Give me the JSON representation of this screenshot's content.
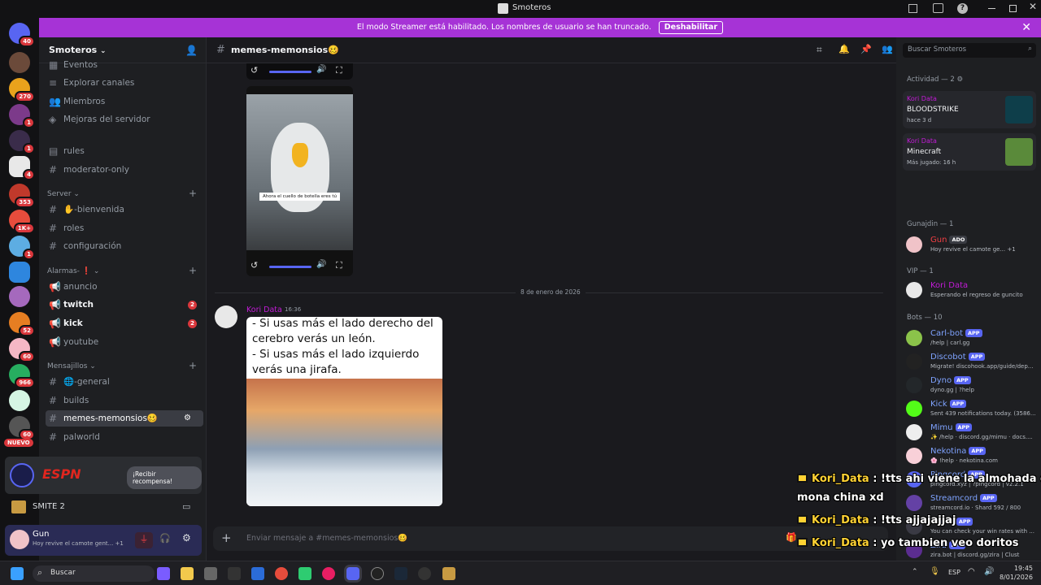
{
  "window": {
    "title": "Smoteros"
  },
  "banner": {
    "text": "El modo Streamer está habilitado. Los nombres de usuario se han truncado.",
    "button": "Deshabilitar"
  },
  "rail": {
    "badges": [
      "40",
      "270",
      "1",
      "1",
      "4",
      "353",
      "1K+",
      "1",
      "52",
      "60",
      "966",
      "60"
    ],
    "new_label": "NUEVO"
  },
  "server": {
    "name": "Smoteros"
  },
  "sidebar": {
    "top_items": [
      {
        "label": "Eventos"
      },
      {
        "label": "Explorar canales"
      },
      {
        "label": "Miembros"
      },
      {
        "label": "Mejoras del servidor"
      }
    ],
    "pre_channels": [
      {
        "label": "rules"
      },
      {
        "label": "moderator-only"
      }
    ],
    "categories": {
      "server": "Server",
      "alarmas": "Alarmas- ❗",
      "mensajillos": "Mensajillos"
    },
    "server_channels": [
      {
        "label": "✋-bienvenida"
      },
      {
        "label": "roles"
      },
      {
        "label": "configuración"
      }
    ],
    "alarm_channels": [
      {
        "label": "anuncio"
      },
      {
        "label": "twitch",
        "count": "2"
      },
      {
        "label": "kick",
        "count": "2"
      },
      {
        "label": "youtube"
      }
    ],
    "msg_channels": [
      {
        "label": "🌐-general"
      },
      {
        "label": "builds"
      },
      {
        "label": "memes-memonsios🥴"
      },
      {
        "label": "palworld"
      }
    ]
  },
  "promo": {
    "brand": "ESPN",
    "button": "¡Recibir recompensa!"
  },
  "game": {
    "name": "SMITE 2"
  },
  "user": {
    "name": "Gun",
    "status": "Hoy revive el camote gent...",
    "extra": "+1"
  },
  "chat": {
    "channel": "memes-memonsios🥴",
    "caption_bird": "Ahora el cuello de botella eres tú",
    "date_divider": "8 de enero de 2026",
    "message": {
      "author": "Kori Data",
      "time": "16:36",
      "image_text": "- Si usas más el lado derecho del cerebro verás un león.\n- Si usas más el lado izquierdo verás una jirafa."
    },
    "composer_placeholder": "Enviar mensaje a #memes-memonsios🥴"
  },
  "members": {
    "search_placeholder": "Buscar Smoteros",
    "activity_header": "Actividad — 2",
    "activity": [
      {
        "user": "Kori Data",
        "game": "BLOODSTRIKE",
        "meta": "hace 3 d"
      },
      {
        "user": "Kori Data",
        "game": "Minecraft",
        "meta": "Más jugado: 16 h"
      }
    ],
    "groups": [
      {
        "header": "Gunajdin — 1",
        "rows": [
          {
            "name": "Gun",
            "tag": "ADO",
            "status": "Hoy revive el camote ge...  +1",
            "color": "#f23f43"
          }
        ]
      },
      {
        "header": "VIP — 1",
        "rows": [
          {
            "name": "Kori Data",
            "status": "Esperando el regreso de guncito",
            "color": "#c21bd6"
          }
        ]
      },
      {
        "header": "Bots — 10",
        "rows": [
          {
            "name": "Carl-bot",
            "status": "/help | carl.gg",
            "color": "#7fa3ff"
          },
          {
            "name": "Discobot",
            "status": "Migrate! discohook.app/guide/dep...",
            "color": "#7fa3ff"
          },
          {
            "name": "Dyno",
            "status": "dyno.gg | ?help",
            "color": "#7fa3ff"
          },
          {
            "name": "Kick",
            "status": "Sent 439 notifications today. (3586...",
            "color": "#7fa3ff"
          },
          {
            "name": "Mimu",
            "status": "✨ /help · discord.gg/mimu · docs....",
            "color": "#7fa3ff"
          },
          {
            "name": "Nekotina",
            "status": "🌸 !help · nekotina.com",
            "color": "#7fa3ff"
          },
          {
            "name": "Pingcord",
            "status": "pingcord.xyz | ?pingcord | v2.2.1",
            "color": "#7fa3ff"
          },
          {
            "name": "Streamcord",
            "status": "streamcord.io · Shard 592 / 800",
            "color": "#7fa3ff"
          },
          {
            "name": "Tnoth",
            "status": "You can check your win rates with ...",
            "color": "#7fa3ff"
          },
          {
            "name": "Zira",
            "status": "zira.bot | discord.gg/zira | Clust",
            "color": "#7fa3ff"
          }
        ]
      }
    ],
    "app_tag": "APP"
  },
  "overlay": [
    {
      "name": "Kori_Data",
      "text": " : !tts ahi viene la almohada de"
    },
    {
      "name": "",
      "text": "mona china xd"
    },
    {
      "name": "Kori_Data",
      "text": " : !tts ajjajajjaj"
    },
    {
      "name": "Kori_Data",
      "text": " : yo tambien veo doritos"
    }
  ],
  "taskbar": {
    "search": "Buscar",
    "lang": "ESP",
    "time": "19:45",
    "date": "8/01/2026"
  },
  "colors": {
    "accent": "#a633d6",
    "username": "#c21bd6",
    "app": "#5865f2",
    "badge": "#da373c"
  }
}
